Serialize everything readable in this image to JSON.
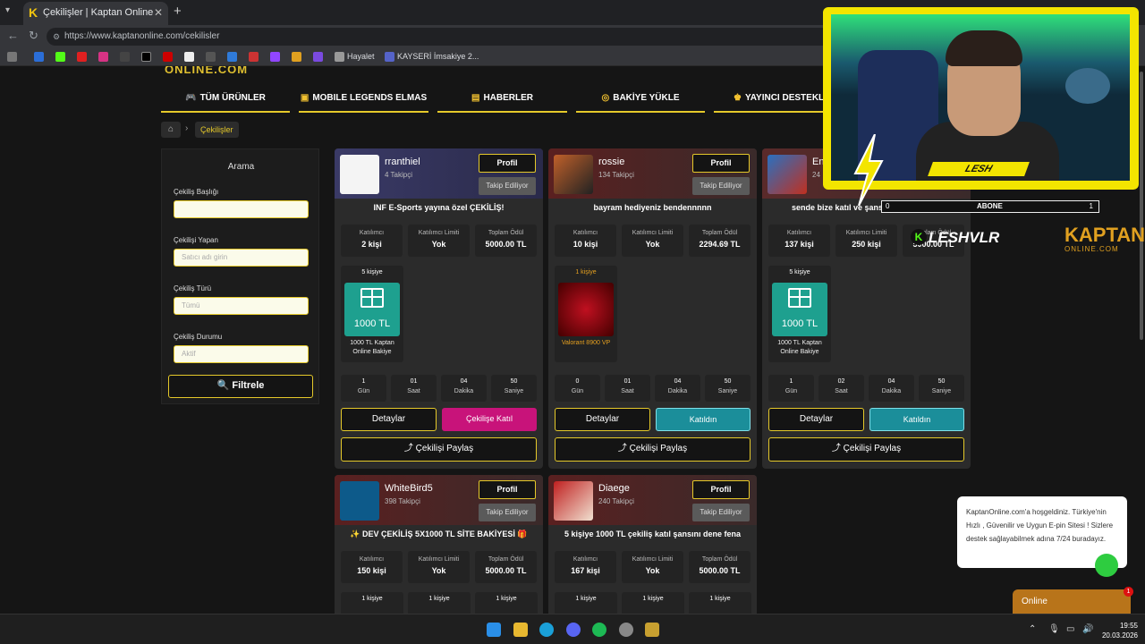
{
  "browser": {
    "tab_title": "Çekilişler | Kaptan Online",
    "url": "https://www.kaptanonline.com/cekilisler",
    "bookmarks": [
      "Hayalet",
      "KAYSERİ İmsakiye 2..."
    ]
  },
  "site": {
    "logo_text": "ONLINE.COM",
    "nav": [
      "TÜM ÜRÜNLER",
      "MOBILE LEGENDS ELMAS",
      "HABERLER",
      "BAKİYE YÜKLE",
      "YAYINCI DESTEKLE"
    ],
    "breadcrumb": [
      "Çekilişler"
    ]
  },
  "sidebar": {
    "title": "Arama",
    "fields": [
      {
        "label": "Çekiliş Başlığı",
        "placeholder": ""
      },
      {
        "label": "Çekilişi Yapan",
        "placeholder": "Satıcı adı girin"
      },
      {
        "label": "Çekiliş Türü",
        "placeholder": "Tümü"
      },
      {
        "label": "Çekiliş Durumu",
        "placeholder": "Aktif"
      }
    ],
    "filter_button": "Filtrele"
  },
  "labels": {
    "profile": "Profil",
    "following": "Takip Ediliyor",
    "participants": "Katılımcı",
    "limit": "Katılımcı Limiti",
    "total": "Toplam Ödül",
    "details": "Detaylar",
    "share": "Çekilişi Paylaş",
    "units": [
      "Gün",
      "Saat",
      "Dakika",
      "Saniye"
    ]
  },
  "cards": [
    {
      "user": "rranthiel",
      "followers": "4 Takipçi",
      "title": "INF E-Sports yayına özel ÇEKİLİŞ!",
      "participants": "2 kişi",
      "limit": "Yok",
      "total": "5000.00 TL",
      "prize_count": "5 kişiye",
      "prize_amount": "1000 TL",
      "prize_name": "1000 TL Kaptan Online Bakiye",
      "countdown": [
        "1",
        "01",
        "04",
        "50"
      ],
      "action": "Çekilişe Katıl"
    },
    {
      "user": "rossie",
      "followers": "134 Takipçi",
      "title": "bayram hediyeniz bendennnnn",
      "participants": "10 kişi",
      "limit": "Yok",
      "total": "2294.69 TL",
      "prize_count": "1 kişiye",
      "prize_amount": "",
      "prize_name": "Valorant 8900 VP",
      "countdown": [
        "0",
        "01",
        "04",
        "50"
      ],
      "action": "Katıldın"
    },
    {
      "user": "En",
      "followers": "24",
      "title": "sende bize katıl ve şansını değerlendir!",
      "participants": "137 kişi",
      "limit": "250 kişi",
      "total": "5000.00 TL",
      "prize_count": "5 kişiye",
      "prize_amount": "1000 TL",
      "prize_name": "1000 TL Kaptan Online Bakiye",
      "countdown": [
        "1",
        "02",
        "04",
        "50"
      ],
      "action": "Katıldın"
    },
    {
      "user": "WhiteBird5",
      "followers": "398 Takipçi",
      "title": "✨ DEV ÇEKİLİŞ 5X1000 TL SİTE BAKİYESİ 🎁",
      "participants": "150 kişi",
      "limit": "Yok",
      "total": "5000.00 TL",
      "prize_count": "1 kişiye"
    },
    {
      "user": "Diaege",
      "followers": "240 Takipçi",
      "title": "5 kişiye 1000 TL çekiliş katıl şansını dene fena",
      "participants": "167 kişi",
      "limit": "Yok",
      "total": "5000.00 TL",
      "prize_count": "1 kişiye"
    }
  ],
  "chat": {
    "message": "KaptanOnline.com'a hoşgeldiniz. Türkiye'nin Hızlı , Güvenilir ve Uygun E-pin Sitesi ! Sizlere destek sağlayabilmek adına 7/24 buradayız.",
    "status": "Online",
    "badge": "1"
  },
  "overlay": {
    "streamer": "LESH",
    "abone_label": "ABONE",
    "abone_count": "1",
    "abone_left": "0",
    "kick_name": "LESHVLR",
    "sponsor_line1": "KAPTAN",
    "sponsor_line2": "ONLINE.COM"
  },
  "taskbar": {
    "time": "19:55",
    "date": "20.03.2026"
  },
  "colors": {
    "accent": "#e5c92a",
    "join": "#c8137a",
    "joined": "#1b8e9a"
  }
}
